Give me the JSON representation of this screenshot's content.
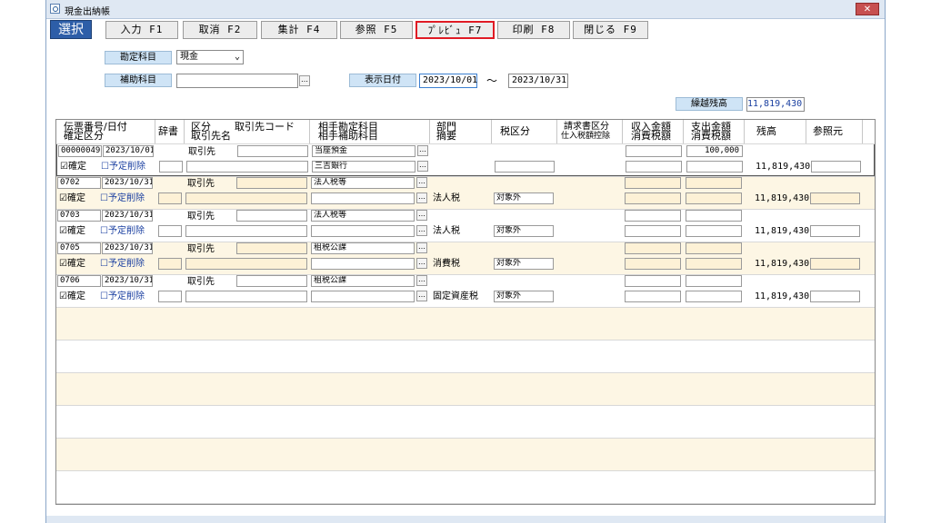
{
  "window": {
    "title": "現金出納帳",
    "close_glyph": "✕"
  },
  "select_label": "選択",
  "toolbar": [
    {
      "label": "入力 F1"
    },
    {
      "label": "取消 F2"
    },
    {
      "label": "集計 F4"
    },
    {
      "label": "参照 F5"
    },
    {
      "label": "ﾌﾟﾚﾋﾞｭ F7"
    },
    {
      "label": "印刷 F8"
    },
    {
      "label": "閉じる F9"
    }
  ],
  "filters": {
    "account_label": "勘定科目",
    "account_value": "現金",
    "sub_account_label": "補助科目",
    "sub_account_value": "",
    "date_label": "表示日付",
    "date_from": "2023/10/01",
    "tilde": "～",
    "date_to": "2023/10/31",
    "carry_label": "繰越残高",
    "carry_value": "11,819,430"
  },
  "headers": {
    "slip": "伝票番号/日付",
    "confirm": "確定区分",
    "dict": "辞書",
    "kubun": "区分",
    "partner_code": "取引先コード",
    "partner_name": "取引先名",
    "counter_account": "相手勘定科目",
    "counter_sub": "相手補助科目",
    "dept": "部門",
    "summary": "摘要",
    "tax": "税区分",
    "invoice": "請求書区分",
    "deduct": "仕入税額控除",
    "income": "収入金額",
    "income_tax": "消費税額",
    "expense": "支出金額",
    "expense_tax": "消費税額",
    "balance": "残高",
    "ref": "参照元"
  },
  "rows": [
    {
      "slip": "00000049",
      "date": "2023/10/01",
      "confirm": "☑確定",
      "plan": "☐予定削除",
      "kubun": "取引先",
      "account": "当座預金",
      "sub": "三吉銀行",
      "summary": "",
      "tax": "",
      "expense": "100,000",
      "balance": "11,819,430"
    },
    {
      "slip": "0702",
      "date": "2023/10/31",
      "confirm": "☑確定",
      "plan": "☐予定削除",
      "kubun": "取引先",
      "account": "法人税等",
      "sub": "",
      "summary": "法人税",
      "tax": "対象外",
      "expense": "",
      "balance": "11,819,430"
    },
    {
      "slip": "0703",
      "date": "2023/10/31",
      "confirm": "☑確定",
      "plan": "☐予定削除",
      "kubun": "取引先",
      "account": "法人税等",
      "sub": "",
      "summary": "法人税",
      "tax": "対象外",
      "expense": "",
      "balance": "11,819,430"
    },
    {
      "slip": "0705",
      "date": "2023/10/31",
      "confirm": "☑確定",
      "plan": "☐予定削除",
      "kubun": "取引先",
      "account": "租税公課",
      "sub": "",
      "summary": "消費税",
      "tax": "対象外",
      "expense": "",
      "balance": "11,819,430"
    },
    {
      "slip": "0706",
      "date": "2023/10/31",
      "confirm": "☑確定",
      "plan": "☐予定削除",
      "kubun": "取引先",
      "account": "租税公課",
      "sub": "",
      "summary": "固定資産税",
      "tax": "対象外",
      "expense": "",
      "balance": "11,819,430"
    }
  ],
  "colors": {
    "accent": "#2d5ea8",
    "highlight": "#e01b24",
    "row_alt": "#fdf6e4"
  }
}
